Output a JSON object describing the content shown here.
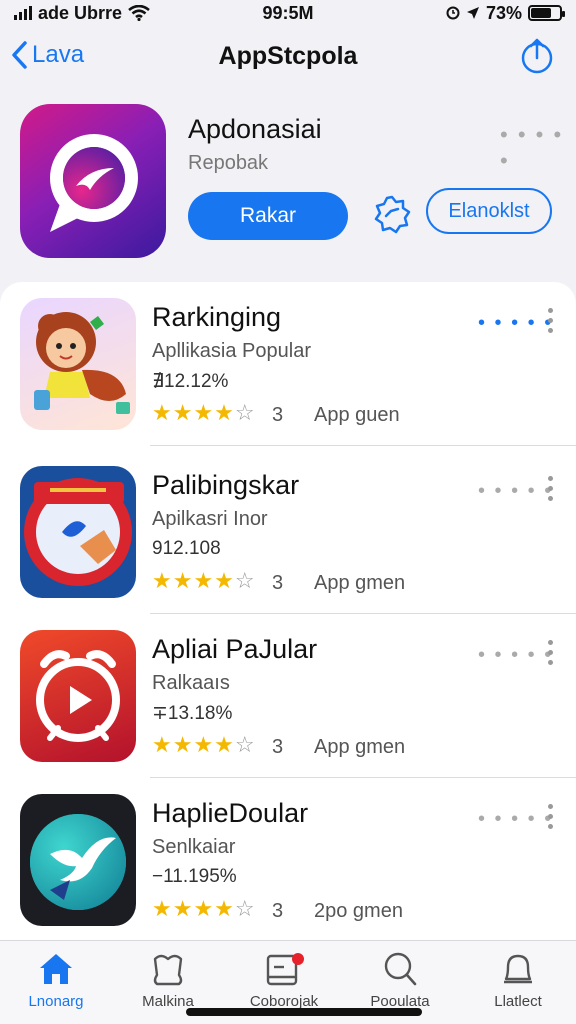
{
  "status_bar": {
    "carrier": "ade Ubrre",
    "time": "99:5M",
    "battery": "73%",
    "battery_level": 0.73
  },
  "nav": {
    "back_label": "Lava",
    "title": "AppStcpola"
  },
  "hero": {
    "title": "Apdonasiai",
    "subtitle": "Repobak",
    "primary_button": "Rakar",
    "secondary_button": "Elanoklst"
  },
  "apps": [
    {
      "title": "Rarkinging",
      "subtitle": "Apllikasia Popular",
      "price": "∄12.12%",
      "rating": 4,
      "stars": "★★★★",
      "empty_star": "☆",
      "count": "3",
      "genre": "App guen"
    },
    {
      "title": "Palibingskar",
      "subtitle": "Apilkasri Inor",
      "price": "912.108",
      "rating": 4,
      "stars": "★★★★",
      "empty_star": "☆",
      "count": "3",
      "genre": "App gmen"
    },
    {
      "title": "Apliai PaJular",
      "subtitle": "Ralkaaıs",
      "price": "∓13.18%",
      "rating": 4,
      "stars": "★★★★",
      "empty_star": "☆",
      "count": "3",
      "genre": "App gmen"
    },
    {
      "title": "HaplieDoular",
      "subtitle": "Senlkaiar",
      "price": "−11.195%",
      "rating": 4,
      "stars": "★★★★",
      "empty_star": "☆",
      "count": "3",
      "genre": "2po gmen"
    }
  ],
  "tabs": [
    {
      "label": "Lnonarg",
      "icon": "home-icon"
    },
    {
      "label": "Malkina",
      "icon": "bookmark-icon"
    },
    {
      "label": "Coborojak",
      "icon": "inbox-icon"
    },
    {
      "label": "Pooulata",
      "icon": "search-icon"
    },
    {
      "label": "Llatlect",
      "icon": "bell-icon"
    }
  ],
  "colors": {
    "accent": "#1876f0",
    "star": "#f5b800",
    "badge": "#e6212b"
  }
}
